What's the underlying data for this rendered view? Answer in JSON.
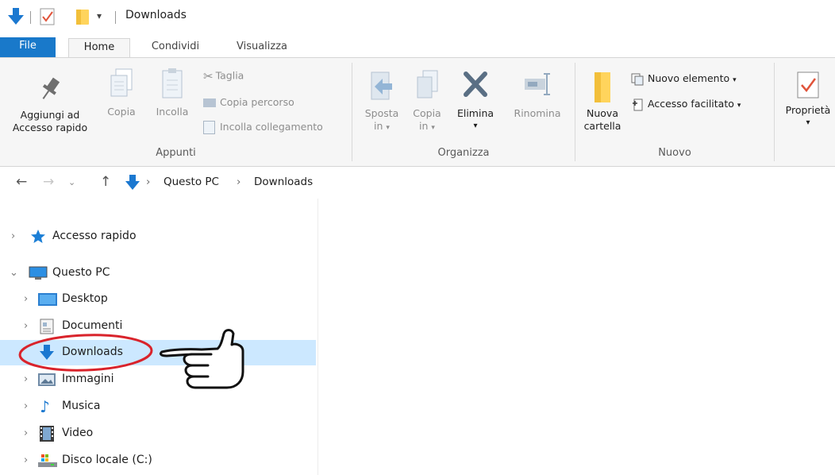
{
  "window": {
    "title": "Downloads"
  },
  "tabs": {
    "file": "File",
    "home": "Home",
    "share": "Condividi",
    "view": "Visualizza"
  },
  "ribbon": {
    "clipboard": {
      "label": "Appunti",
      "pin_line1": "Aggiungi ad",
      "pin_line2": "Accesso rapido",
      "copy": "Copia",
      "paste": "Incolla",
      "cut": "Taglia",
      "copy_path": "Copia percorso",
      "paste_shortcut": "Incolla collegamento"
    },
    "organize": {
      "label": "Organizza",
      "move_line1": "Sposta",
      "move_line2": "in",
      "copyto_line1": "Copia",
      "copyto_line2": "in",
      "delete": "Elimina",
      "rename": "Rinomina"
    },
    "new": {
      "label": "Nuovo",
      "folder_line1": "Nuova",
      "folder_line2": "cartella",
      "new_item": "Nuovo elemento",
      "easy_access": "Accesso facilitato"
    },
    "open": {
      "properties": "Proprietà"
    }
  },
  "address": {
    "crumbs": [
      "Questo PC",
      "Downloads"
    ]
  },
  "nav": {
    "items": [
      {
        "label": "Accesso rapido"
      },
      {
        "label": "Questo PC"
      },
      {
        "label": "Desktop"
      },
      {
        "label": "Documenti"
      },
      {
        "label": "Downloads"
      },
      {
        "label": "Immagini"
      },
      {
        "label": "Musica"
      },
      {
        "label": "Video"
      },
      {
        "label": "Disco locale (C:)"
      }
    ]
  },
  "colors": {
    "accent": "#1979ca",
    "selected": "#cce8ff",
    "annotation": "#d9232b"
  },
  "icons": [
    "down-arrow-icon",
    "properties-icon",
    "folder-icon",
    "pin-icon",
    "copy-icon",
    "paste-icon",
    "scissors-icon",
    "delete-icon",
    "rename-icon",
    "star-icon",
    "pc-icon",
    "desktop-icon",
    "document-icon",
    "image-icon",
    "music-icon",
    "video-icon",
    "drive-icon",
    "pointing-hand-icon"
  ]
}
